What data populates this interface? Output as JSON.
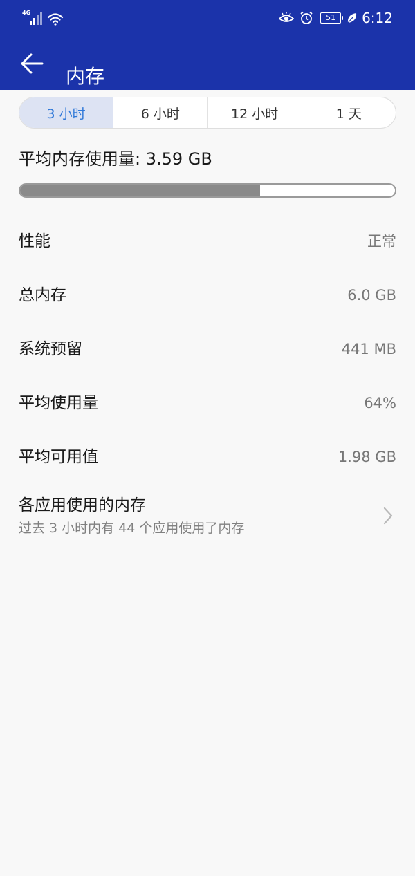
{
  "status_bar": {
    "network_type": "4G",
    "battery_level": "51",
    "time": "6:12",
    "icons": [
      "signal-icon",
      "wifi-icon",
      "eye-comfort-icon",
      "alarm-icon",
      "battery-icon",
      "power-saving-leaf-icon"
    ]
  },
  "app_bar": {
    "title": "内存",
    "back_icon": "back-arrow-icon"
  },
  "tabs": [
    {
      "label": "3 小时",
      "selected": true
    },
    {
      "label": "6 小时",
      "selected": false
    },
    {
      "label": "12 小时",
      "selected": false
    },
    {
      "label": "1 天",
      "selected": false
    }
  ],
  "average_usage": {
    "text": "平均内存使用量: 3.59 GB",
    "fraction": 0.64
  },
  "info_rows": [
    {
      "label": "性能",
      "value": "正常"
    },
    {
      "label": "总内存",
      "value": "6.0 GB"
    },
    {
      "label": "系统预留",
      "value": "441 MB"
    },
    {
      "label": "平均使用量",
      "value": "64%"
    },
    {
      "label": "平均可用值",
      "value": "1.98 GB"
    }
  ],
  "app_memory": {
    "title": "各应用使用的内存",
    "subtitle": "过去 3 小时内有 44 个应用使用了内存",
    "icon": "chevron-right-icon"
  },
  "colors": {
    "header_bg": "#1b33aa",
    "page_bg": "#f8f8f8",
    "tab_selected_bg": "#dde3f3",
    "tab_selected_text": "#2f78d8",
    "bar_fill": "#8a8a8a"
  }
}
